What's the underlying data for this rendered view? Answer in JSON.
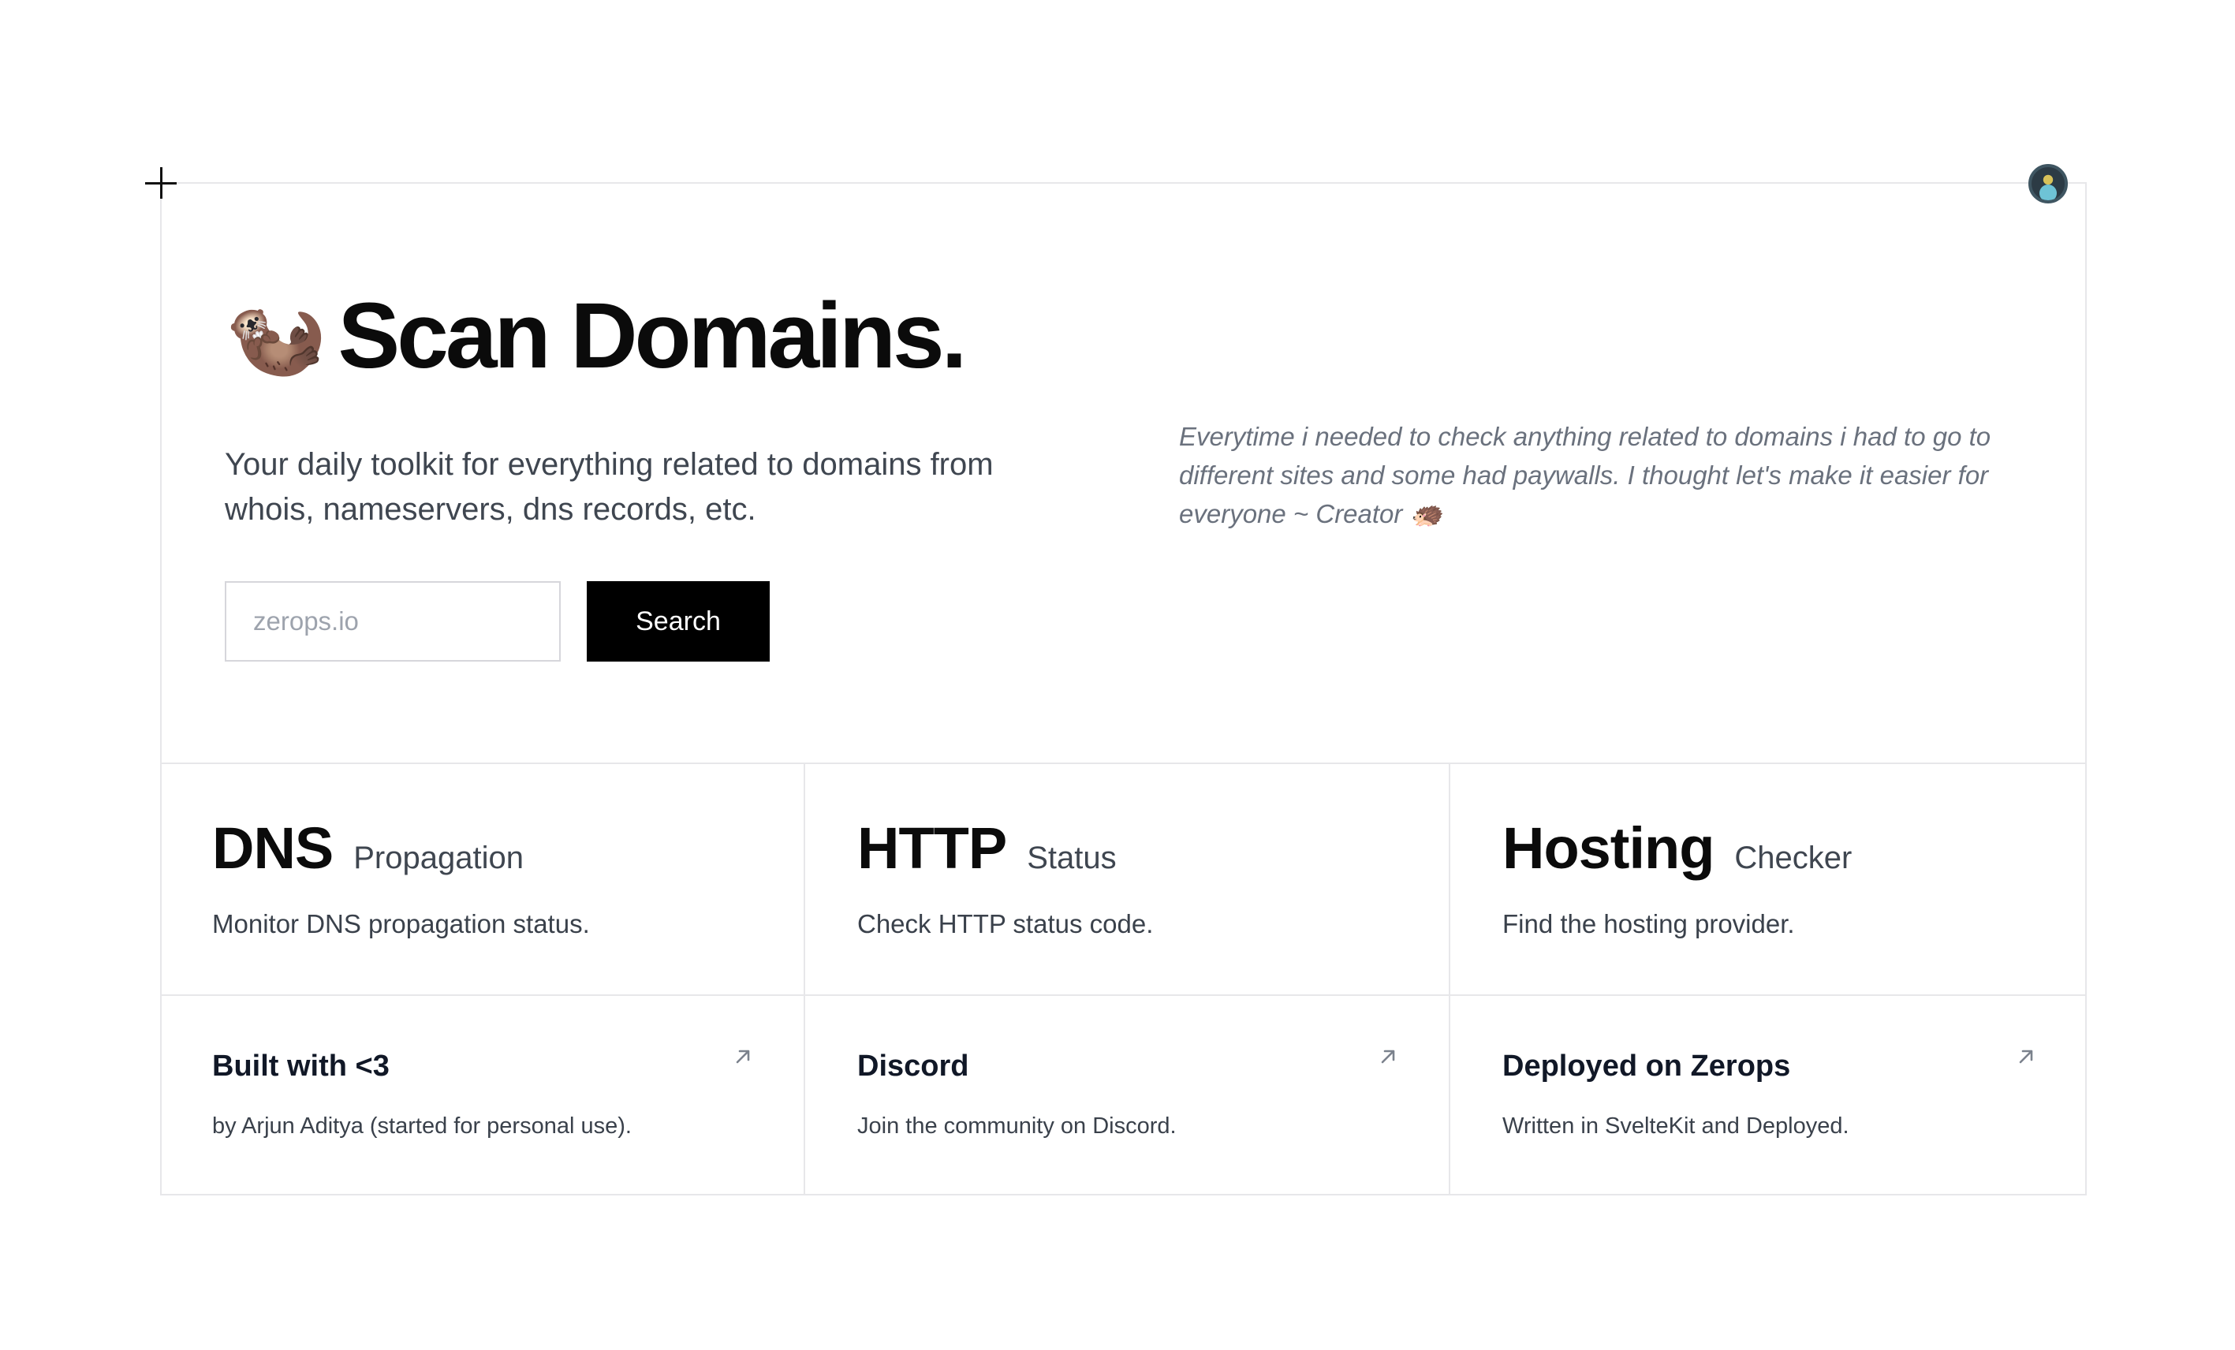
{
  "hero": {
    "emoji": "🦦",
    "title": "Scan Domains.",
    "subtitle": "Your daily toolkit for everything related to domains from whois, nameservers, dns records, etc.",
    "search": {
      "placeholder": "zerops.io",
      "button_label": "Search"
    },
    "quote": "Everytime i needed to check anything related to domains i had to go to different sites and some had paywalls. I thought let's make it easier for everyone ~ Creator 🦔"
  },
  "tools": [
    {
      "name": "DNS",
      "kind": "Propagation",
      "description": "Monitor DNS propagation status."
    },
    {
      "name": "HTTP",
      "kind": "Status",
      "description": "Check HTTP status code."
    },
    {
      "name": "Hosting",
      "kind": "Checker",
      "description": "Find the hosting provider."
    }
  ],
  "links": [
    {
      "title": "Built with <3",
      "description": "by Arjun Aditya (started for personal use).",
      "icon": "arrow-up-right-icon"
    },
    {
      "title": "Discord",
      "description": "Join the community on Discord.",
      "icon": "arrow-up-right-icon"
    },
    {
      "title": "Deployed on Zerops",
      "description": "Written in SvelteKit and Deployed.",
      "icon": "arrow-up-right-icon"
    }
  ],
  "colors": {
    "border": "#e7e7ea",
    "button_bg": "#000000",
    "button_text": "#ffffff",
    "muted_text": "#6a717d"
  }
}
